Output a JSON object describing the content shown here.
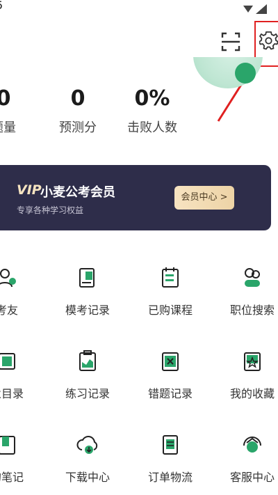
{
  "status_bar": {
    "time": "5"
  },
  "header": {
    "scan_icon": "scan-icon",
    "settings_icon": "gear-icon"
  },
  "stats": [
    {
      "value": "0",
      "label": "题量"
    },
    {
      "value": "0",
      "label": "预测分"
    },
    {
      "value": "0%",
      "label": "击败人数"
    }
  ],
  "vip": {
    "logo": "VIP",
    "title": "小麦公考会员",
    "subtitle": "专享各种学习权益",
    "button": "会员中心 >"
  },
  "menu": [
    {
      "label": "考友",
      "icon": "friends-icon"
    },
    {
      "label": "模考记录",
      "icon": "mock-exam-icon"
    },
    {
      "label": "已购课程",
      "icon": "purchased-course-icon"
    },
    {
      "label": "职位搜索",
      "icon": "job-search-icon"
    },
    {
      "label": "业目录",
      "icon": "catalog-icon"
    },
    {
      "label": "练习记录",
      "icon": "practice-record-icon"
    },
    {
      "label": "错题记录",
      "icon": "wrong-question-icon"
    },
    {
      "label": "我的收藏",
      "icon": "favorites-icon"
    },
    {
      "label": "的笔记",
      "icon": "notes-icon"
    },
    {
      "label": "下载中心",
      "icon": "download-center-icon"
    },
    {
      "label": "订单物流",
      "icon": "order-logistics-icon"
    },
    {
      "label": "客服中心",
      "icon": "customer-service-icon"
    }
  ],
  "colors": {
    "accent": "#2aa56a",
    "vip_bg": "#2e2d4a",
    "highlight": "#e02020"
  }
}
